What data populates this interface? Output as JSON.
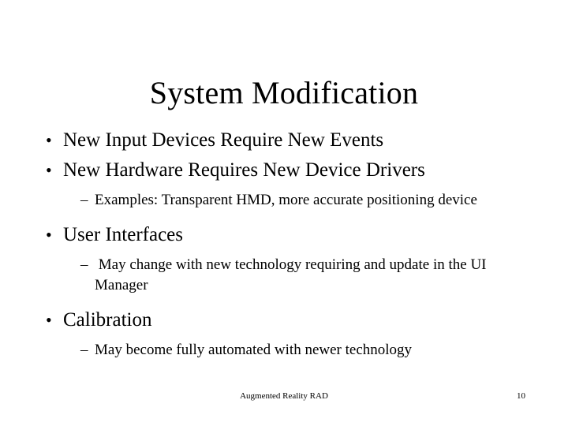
{
  "slide": {
    "title": "System Modification",
    "bullets": [
      {
        "level": 1,
        "marker": "•",
        "text": "New Input Devices Require New Events"
      },
      {
        "level": 1,
        "marker": "•",
        "text": "New Hardware Requires New Device Drivers"
      },
      {
        "level": 2,
        "marker": "–",
        "text": "Examples: Transparent HMD, more accurate positioning device"
      },
      {
        "level": 1,
        "marker": "•",
        "text": "User Interfaces"
      },
      {
        "level": 2,
        "marker": "–",
        "text": " May change with new technology requiring and update in the UI Manager"
      },
      {
        "level": 1,
        "marker": "•",
        "text": "Calibration"
      },
      {
        "level": 2,
        "marker": "–",
        "text": "May become fully automated with newer technology"
      }
    ],
    "footer": {
      "center_text": "Augmented Reality RAD",
      "page_number": "10"
    }
  }
}
